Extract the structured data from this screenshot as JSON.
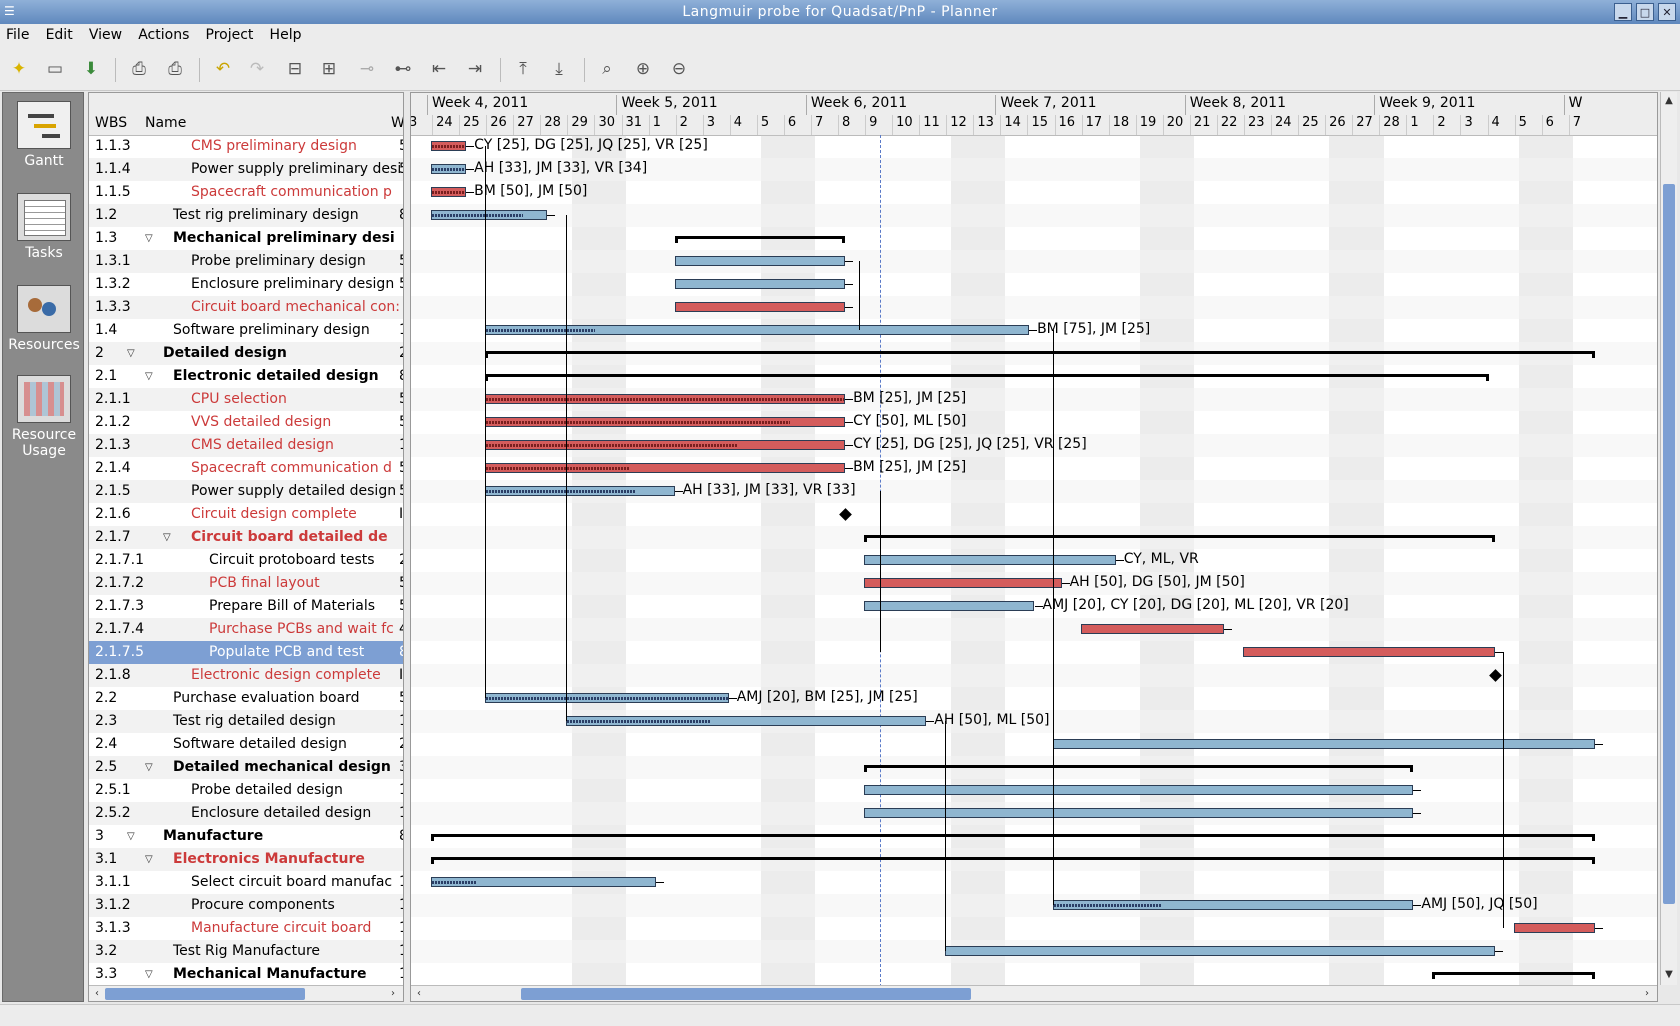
{
  "window": {
    "title": "Langmuir probe for Quadsat/PnP - Planner"
  },
  "menu": [
    "File",
    "Edit",
    "View",
    "Actions",
    "Project",
    "Help"
  ],
  "nav": [
    {
      "label": "Gantt"
    },
    {
      "label": "Tasks"
    },
    {
      "label": "Resources"
    },
    {
      "label": "Resource Usage"
    }
  ],
  "columns": {
    "wbs": "WBS",
    "name": "Name",
    "extra": "W"
  },
  "weeks": [
    "Week 4, 2011",
    "Week 5, 2011",
    "Week 6, 2011",
    "Week 7, 2011",
    "Week 8, 2011",
    "Week 9, 2011",
    "W"
  ],
  "days": [
    "3",
    "24",
    "25",
    "26",
    "27",
    "28",
    "29",
    "30",
    "31",
    "1",
    "2",
    "3",
    "4",
    "5",
    "6",
    "7",
    "8",
    "9",
    "10",
    "11",
    "12",
    "13",
    "14",
    "15",
    "16",
    "17",
    "18",
    "19",
    "20",
    "21",
    "22",
    "23",
    "24",
    "25",
    "26",
    "27",
    "28",
    "1",
    "2",
    "3",
    "4",
    "5",
    "6",
    "7"
  ],
  "tasks": [
    {
      "wbs": "1.1.3",
      "name": "CMS preliminary design",
      "level": 2,
      "red": true,
      "bold": false,
      "tri": false,
      "extra": "5"
    },
    {
      "wbs": "1.1.4",
      "name": "Power supply preliminary desi",
      "level": 2,
      "red": false,
      "bold": false,
      "tri": false,
      "extra": "5"
    },
    {
      "wbs": "1.1.5",
      "name": "Spacecraft communication p",
      "level": 2,
      "red": true,
      "bold": false,
      "tri": false,
      "extra": ""
    },
    {
      "wbs": "1.2",
      "name": "Test rig preliminary design",
      "level": 1,
      "red": false,
      "bold": false,
      "tri": false,
      "extra": "8"
    },
    {
      "wbs": "1.3",
      "name": "Mechanical preliminary desi",
      "level": 1,
      "red": false,
      "bold": true,
      "tri": true,
      "extra": ""
    },
    {
      "wbs": "1.3.1",
      "name": "Probe preliminary design",
      "level": 2,
      "red": false,
      "bold": false,
      "tri": false,
      "extra": "5"
    },
    {
      "wbs": "1.3.2",
      "name": "Enclosure preliminary design",
      "level": 2,
      "red": false,
      "bold": false,
      "tri": false,
      "extra": "5"
    },
    {
      "wbs": "1.3.3",
      "name": "Circuit board mechanical con:",
      "level": 2,
      "red": true,
      "bold": false,
      "tri": false,
      "extra": ""
    },
    {
      "wbs": "1.4",
      "name": "Software preliminary design",
      "level": 1,
      "red": false,
      "bold": false,
      "tri": false,
      "extra": "1"
    },
    {
      "wbs": "2",
      "name": "Detailed design",
      "level": 0,
      "red": false,
      "bold": true,
      "tri": true,
      "extra": "2"
    },
    {
      "wbs": "2.1",
      "name": "Electronic detailed design",
      "level": 1,
      "red": false,
      "bold": true,
      "tri": true,
      "extra": "8"
    },
    {
      "wbs": "2.1.1",
      "name": "CPU selection",
      "level": 2,
      "red": true,
      "bold": false,
      "tri": false,
      "extra": "5"
    },
    {
      "wbs": "2.1.2",
      "name": "VVS detailed design",
      "level": 2,
      "red": true,
      "bold": false,
      "tri": false,
      "extra": "5"
    },
    {
      "wbs": "2.1.3",
      "name": "CMS detailed design",
      "level": 2,
      "red": true,
      "bold": false,
      "tri": false,
      "extra": "1"
    },
    {
      "wbs": "2.1.4",
      "name": "Spacecraft communication d",
      "level": 2,
      "red": true,
      "bold": false,
      "tri": false,
      "extra": "5"
    },
    {
      "wbs": "2.1.5",
      "name": "Power supply detailed design",
      "level": 2,
      "red": false,
      "bold": false,
      "tri": false,
      "extra": "5"
    },
    {
      "wbs": "2.1.6",
      "name": "Circuit design complete",
      "level": 2,
      "red": true,
      "bold": false,
      "tri": false,
      "extra": "I"
    },
    {
      "wbs": "2.1.7",
      "name": "Circuit board detailed de",
      "level": 2,
      "red": true,
      "bold": true,
      "tri": true,
      "extra": ""
    },
    {
      "wbs": "2.1.7.1",
      "name": "Circuit protoboard tests",
      "level": 3,
      "red": false,
      "bold": false,
      "tri": false,
      "extra": "2"
    },
    {
      "wbs": "2.1.7.2",
      "name": "PCB final layout",
      "level": 3,
      "red": true,
      "bold": false,
      "tri": false,
      "extra": "5"
    },
    {
      "wbs": "2.1.7.3",
      "name": "Prepare Bill of Materials",
      "level": 3,
      "red": false,
      "bold": false,
      "tri": false,
      "extra": "5"
    },
    {
      "wbs": "2.1.7.4",
      "name": "Purchase PCBs and wait fc",
      "level": 3,
      "red": true,
      "bold": false,
      "tri": false,
      "extra": "4"
    },
    {
      "wbs": "2.1.7.5",
      "name": "Populate PCB and test",
      "level": 3,
      "red": true,
      "bold": false,
      "tri": false,
      "extra": "8",
      "selected": true
    },
    {
      "wbs": "2.1.8",
      "name": "Electronic design complete",
      "level": 2,
      "red": true,
      "bold": false,
      "tri": false,
      "extra": "I"
    },
    {
      "wbs": "2.2",
      "name": "Purchase evaluation board",
      "level": 1,
      "red": false,
      "bold": false,
      "tri": false,
      "extra": "5"
    },
    {
      "wbs": "2.3",
      "name": "Test rig detailed design",
      "level": 1,
      "red": false,
      "bold": false,
      "tri": false,
      "extra": "1"
    },
    {
      "wbs": "2.4",
      "name": "Software detailed design",
      "level": 1,
      "red": false,
      "bold": false,
      "tri": false,
      "extra": "2"
    },
    {
      "wbs": "2.5",
      "name": "Detailed mechanical design",
      "level": 1,
      "red": false,
      "bold": true,
      "tri": true,
      "extra": "3"
    },
    {
      "wbs": "2.5.1",
      "name": "Probe detailed design",
      "level": 2,
      "red": false,
      "bold": false,
      "tri": false,
      "extra": "1"
    },
    {
      "wbs": "2.5.2",
      "name": "Enclosure detailed design",
      "level": 2,
      "red": false,
      "bold": false,
      "tri": false,
      "extra": "1"
    },
    {
      "wbs": "3",
      "name": "Manufacture",
      "level": 0,
      "red": false,
      "bold": true,
      "tri": true,
      "extra": "8"
    },
    {
      "wbs": "3.1",
      "name": "Electronics Manufacture",
      "level": 1,
      "red": true,
      "bold": true,
      "tri": true,
      "extra": ""
    },
    {
      "wbs": "3.1.1",
      "name": "Select circuit board manufac",
      "level": 2,
      "red": false,
      "bold": false,
      "tri": false,
      "extra": "1"
    },
    {
      "wbs": "3.1.2",
      "name": "Procure components",
      "level": 2,
      "red": false,
      "bold": false,
      "tri": false,
      "extra": "1"
    },
    {
      "wbs": "3.1.3",
      "name": "Manufacture circuit board",
      "level": 2,
      "red": true,
      "bold": false,
      "tri": false,
      "extra": "1"
    },
    {
      "wbs": "3.2",
      "name": "Test Rig Manufacture",
      "level": 1,
      "red": false,
      "bold": false,
      "tri": false,
      "extra": "1"
    },
    {
      "wbs": "3.3",
      "name": "Mechanical Manufacture",
      "level": 1,
      "red": false,
      "bold": true,
      "tri": true,
      "extra": "1"
    }
  ],
  "gantt": [
    {
      "type": "bar",
      "color": "red",
      "start": 0,
      "end": 1.3,
      "progress": 1.0,
      "label": "CY [25], DG [25], JQ [25], VR [25]"
    },
    {
      "type": "bar",
      "color": "blue",
      "start": 0,
      "end": 1.3,
      "progress": 1.0,
      "label": "AH [33], JM [33], VR [34]"
    },
    {
      "type": "bar",
      "color": "red",
      "start": 0,
      "end": 1.3,
      "progress": 1.0,
      "label": "BM [50], JM [50]"
    },
    {
      "type": "bar",
      "color": "blue",
      "start": 0,
      "end": 4.3,
      "progress": 0.8,
      "label": ""
    },
    {
      "type": "summary",
      "start": 9,
      "end": 15.3
    },
    {
      "type": "bar",
      "color": "blue",
      "start": 9,
      "end": 15.3,
      "progress": 0,
      "label": ""
    },
    {
      "type": "bar",
      "color": "blue",
      "start": 9,
      "end": 15.3,
      "progress": 0,
      "label": ""
    },
    {
      "type": "bar",
      "color": "red",
      "start": 9,
      "end": 15.3,
      "progress": 0,
      "label": ""
    },
    {
      "type": "bar",
      "color": "blue",
      "start": 2,
      "end": 22.1,
      "progress": 0.2,
      "label": "BM [75], JM [25]"
    },
    {
      "type": "summary",
      "start": 2,
      "end": 43
    },
    {
      "type": "summary",
      "start": 2,
      "end": 39.1
    },
    {
      "type": "bar",
      "color": "red",
      "start": 2,
      "end": 15.3,
      "progress": 1.0,
      "label": "BM [25], JM [25]"
    },
    {
      "type": "bar",
      "color": "red",
      "start": 2,
      "end": 15.3,
      "progress": 0.85,
      "label": "CY [50], ML [50]"
    },
    {
      "type": "bar",
      "color": "red",
      "start": 2,
      "end": 15.3,
      "progress": 0.7,
      "label": "CY [25], DG [25], JQ [25], VR [25]"
    },
    {
      "type": "bar",
      "color": "red",
      "start": 2,
      "end": 15.3,
      "progress": 0.4,
      "label": "BM [25], JM [25]"
    },
    {
      "type": "bar",
      "color": "blue",
      "start": 2,
      "end": 9,
      "progress": 0.8,
      "label": "AH [33], JM [33], VR [33]"
    },
    {
      "type": "milestone",
      "start": 15.3
    },
    {
      "type": "summary",
      "start": 16,
      "end": 39.3
    },
    {
      "type": "bar",
      "color": "blue",
      "start": 16,
      "end": 25.3,
      "progress": 0,
      "label": "CY, ML, VR"
    },
    {
      "type": "bar",
      "color": "red",
      "start": 16,
      "end": 23.3,
      "progress": 0,
      "label": "AH [50], DG [50], JM [50]"
    },
    {
      "type": "bar",
      "color": "blue",
      "start": 16,
      "end": 22.3,
      "progress": 0,
      "label": "AMJ [20], CY [20], DG [20], ML [20], VR [20]"
    },
    {
      "type": "bar",
      "color": "red",
      "start": 24,
      "end": 29.3,
      "progress": 0,
      "label": ""
    },
    {
      "type": "bar",
      "color": "red",
      "start": 30,
      "end": 39.3,
      "progress": 0,
      "label": ""
    },
    {
      "type": "milestone",
      "start": 39.3
    },
    {
      "type": "bar",
      "color": "blue",
      "start": 2,
      "end": 11,
      "progress": 1.0,
      "label": "AMJ [20], BM [25], JM [25]"
    },
    {
      "type": "bar",
      "color": "blue",
      "start": 5,
      "end": 18.3,
      "progress": 0.4,
      "label": "AH [50], ML [50]"
    },
    {
      "type": "bar",
      "color": "blue",
      "start": 23,
      "end": 43,
      "progress": 0,
      "label": ""
    },
    {
      "type": "summary",
      "start": 16,
      "end": 36.3
    },
    {
      "type": "bar",
      "color": "blue",
      "start": 16,
      "end": 36.3,
      "progress": 0,
      "label": ""
    },
    {
      "type": "bar",
      "color": "blue",
      "start": 16,
      "end": 36.3,
      "progress": 0,
      "label": ""
    },
    {
      "type": "summary",
      "start": 0,
      "end": 43
    },
    {
      "type": "summary",
      "start": 0,
      "end": 43
    },
    {
      "type": "bar",
      "color": "blue",
      "start": 0,
      "end": 8.3,
      "progress": 0.2,
      "label": ""
    },
    {
      "type": "bar",
      "color": "blue",
      "start": 23,
      "end": 36.3,
      "progress": 0.3,
      "label": "AMJ [50], JQ [50]"
    },
    {
      "type": "bar",
      "color": "red",
      "start": 40,
      "end": 43,
      "progress": 0,
      "label": ""
    },
    {
      "type": "bar",
      "color": "blue",
      "start": 19,
      "end": 39.3,
      "progress": 0,
      "label": ""
    },
    {
      "type": "summary",
      "start": 37,
      "end": 43
    }
  ],
  "today_day": 16.6,
  "colors": {
    "bar_blue": "#8fb6d0",
    "bar_red": "#d45c5c",
    "critical_text": "#cc3a3a",
    "selection": "#7d9fd3"
  }
}
